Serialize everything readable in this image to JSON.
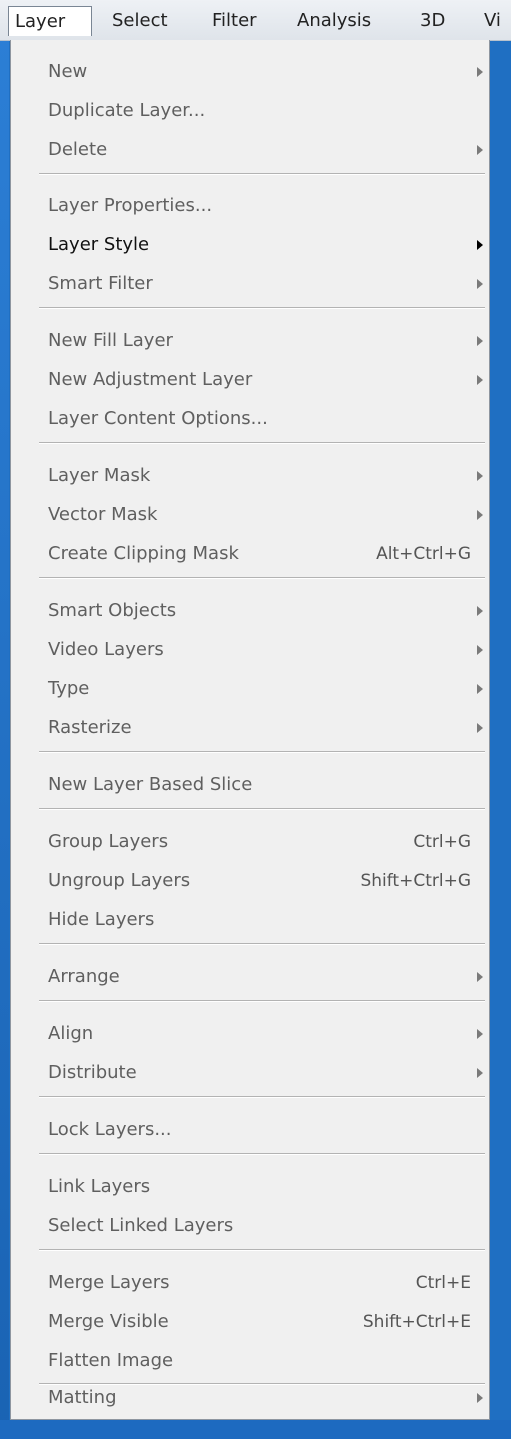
{
  "menubar": {
    "items": [
      "Layer",
      "Select",
      "Filter",
      "Analysis",
      "3D",
      "Vi"
    ]
  },
  "menu": {
    "items": [
      {
        "label": "New",
        "submenu": true
      },
      {
        "label": "Duplicate Layer..."
      },
      {
        "label": "Delete",
        "submenu": true
      },
      {
        "label": "Layer Properties..."
      },
      {
        "label": "Layer Style",
        "submenu": true,
        "enabled": true
      },
      {
        "label": "Smart Filter",
        "submenu": true
      },
      {
        "label": "New Fill Layer",
        "submenu": true
      },
      {
        "label": "New Adjustment Layer",
        "submenu": true
      },
      {
        "label": "Layer Content Options..."
      },
      {
        "label": "Layer Mask",
        "submenu": true
      },
      {
        "label": "Vector Mask",
        "submenu": true
      },
      {
        "label": "Create Clipping Mask",
        "shortcut": "Alt+Ctrl+G"
      },
      {
        "label": "Smart Objects",
        "submenu": true
      },
      {
        "label": "Video Layers",
        "submenu": true
      },
      {
        "label": "Type",
        "submenu": true
      },
      {
        "label": "Rasterize",
        "submenu": true
      },
      {
        "label": "New Layer Based Slice"
      },
      {
        "label": "Group Layers",
        "shortcut": "Ctrl+G"
      },
      {
        "label": "Ungroup Layers",
        "shortcut": "Shift+Ctrl+G"
      },
      {
        "label": "Hide Layers"
      },
      {
        "label": "Arrange",
        "submenu": true
      },
      {
        "label": "Align",
        "submenu": true
      },
      {
        "label": "Distribute",
        "submenu": true
      },
      {
        "label": "Lock Layers..."
      },
      {
        "label": "Link Layers"
      },
      {
        "label": "Select Linked Layers"
      },
      {
        "label": "Merge Layers",
        "shortcut": "Ctrl+E"
      },
      {
        "label": "Merge Visible",
        "shortcut": "Shift+Ctrl+E"
      },
      {
        "label": "Flatten Image"
      },
      {
        "label": "Matting",
        "submenu": true
      }
    ]
  },
  "colors": {
    "menu_bg": "#f0f0f0",
    "disabled_text": "#5f5f5f",
    "enabled_text": "#111111",
    "desktop_blue": "#1f6fc2"
  }
}
